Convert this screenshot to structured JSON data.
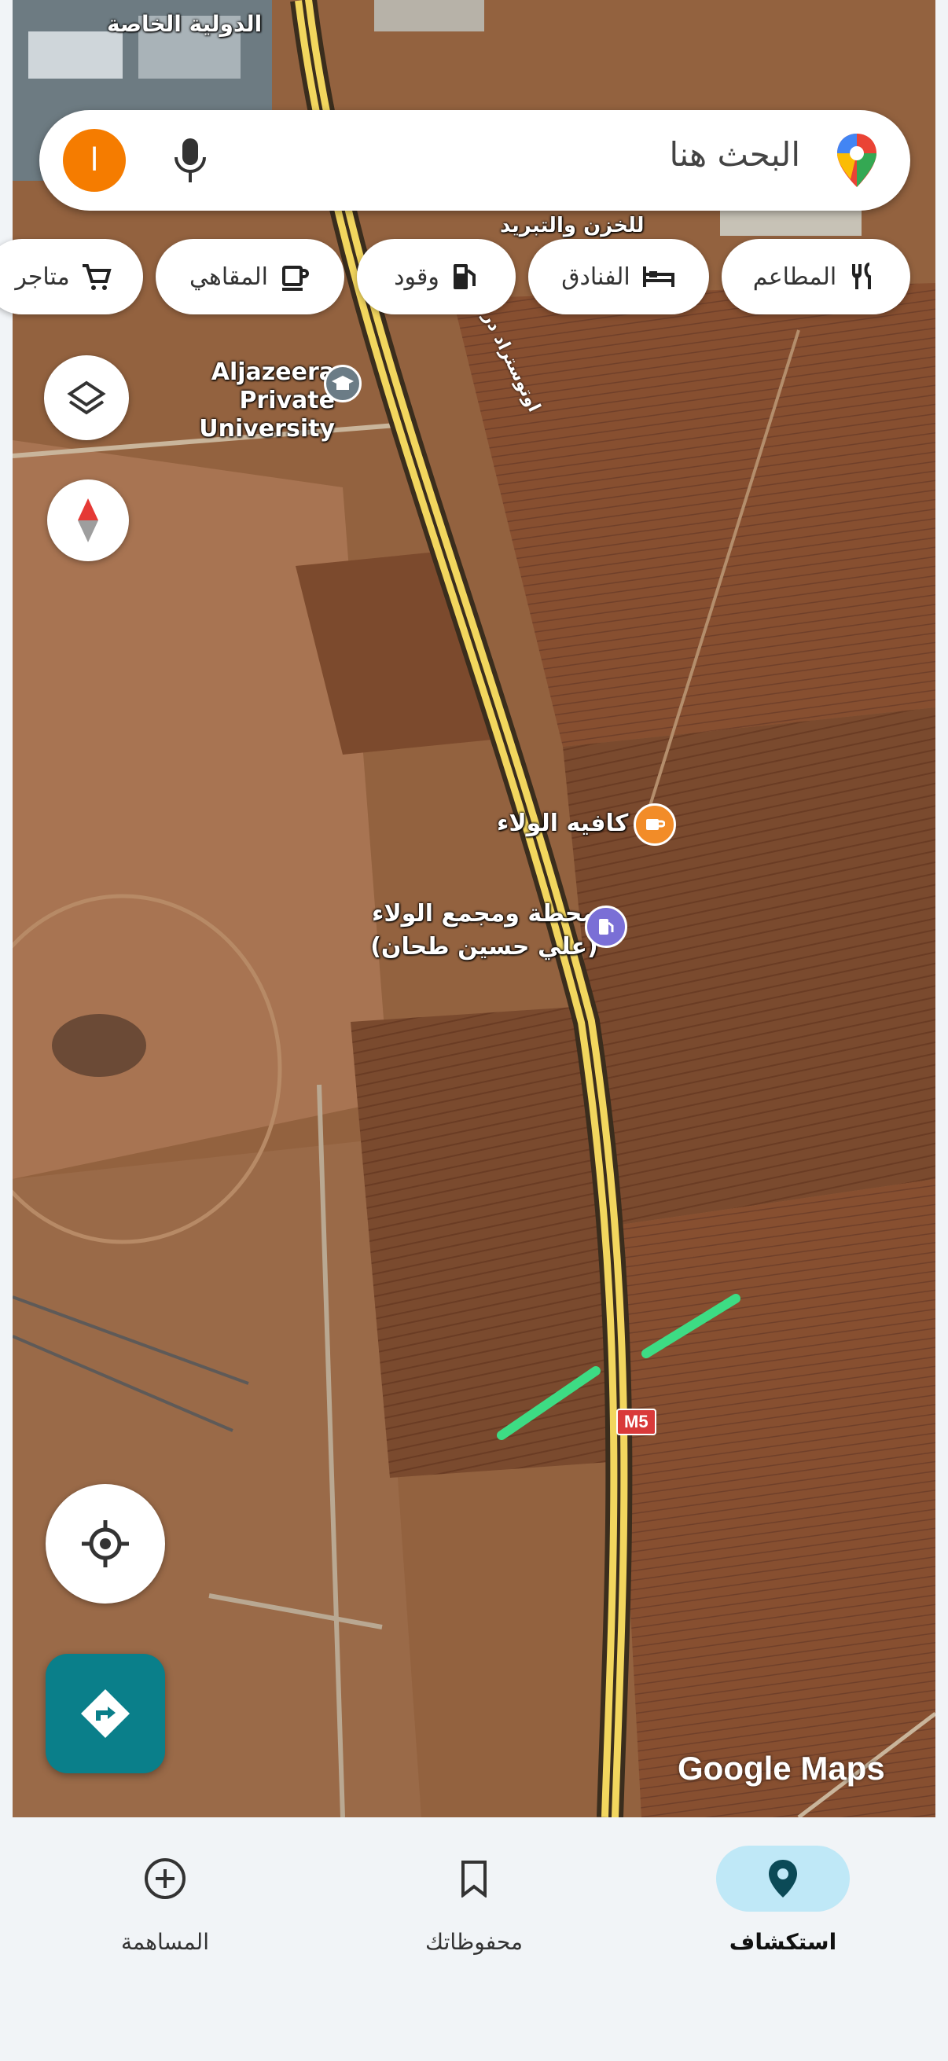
{
  "search": {
    "placeholder": "البحث هنا",
    "avatar_letter": "ا"
  },
  "chips": [
    {
      "label": "المطاعم",
      "icon": "restaurant-icon"
    },
    {
      "label": "الفنادق",
      "icon": "hotel-icon"
    },
    {
      "label": "وقود",
      "icon": "gas-station-icon"
    },
    {
      "label": "المقاهي",
      "icon": "cafe-icon"
    },
    {
      "label": "متاجر",
      "icon": "shopping-cart-icon"
    }
  ],
  "map": {
    "labels": {
      "university": "Aljazeera Private University",
      "cafe": "كافيه الولاء",
      "station": "محطة ومجمع الولاء (علي حسين طحان)",
      "road_name": "اوتوستراد درعا الدولي",
      "road_shield": "M5",
      "top_cut_1": "الدولية الخاصة",
      "top_cut_2": "للخزن والتبريد"
    },
    "watermark": "Google Maps",
    "colors": {
      "highlight_line": "#3ddc84",
      "road": "#f2d65e"
    }
  },
  "bottom_nav": {
    "items": [
      {
        "label": "استكشاف",
        "icon": "location-pin-icon",
        "active": true
      },
      {
        "label": "محفوظاتك",
        "icon": "bookmark-icon",
        "active": false
      },
      {
        "label": "المساهمة",
        "icon": "add-circle-icon",
        "active": false
      }
    ]
  }
}
